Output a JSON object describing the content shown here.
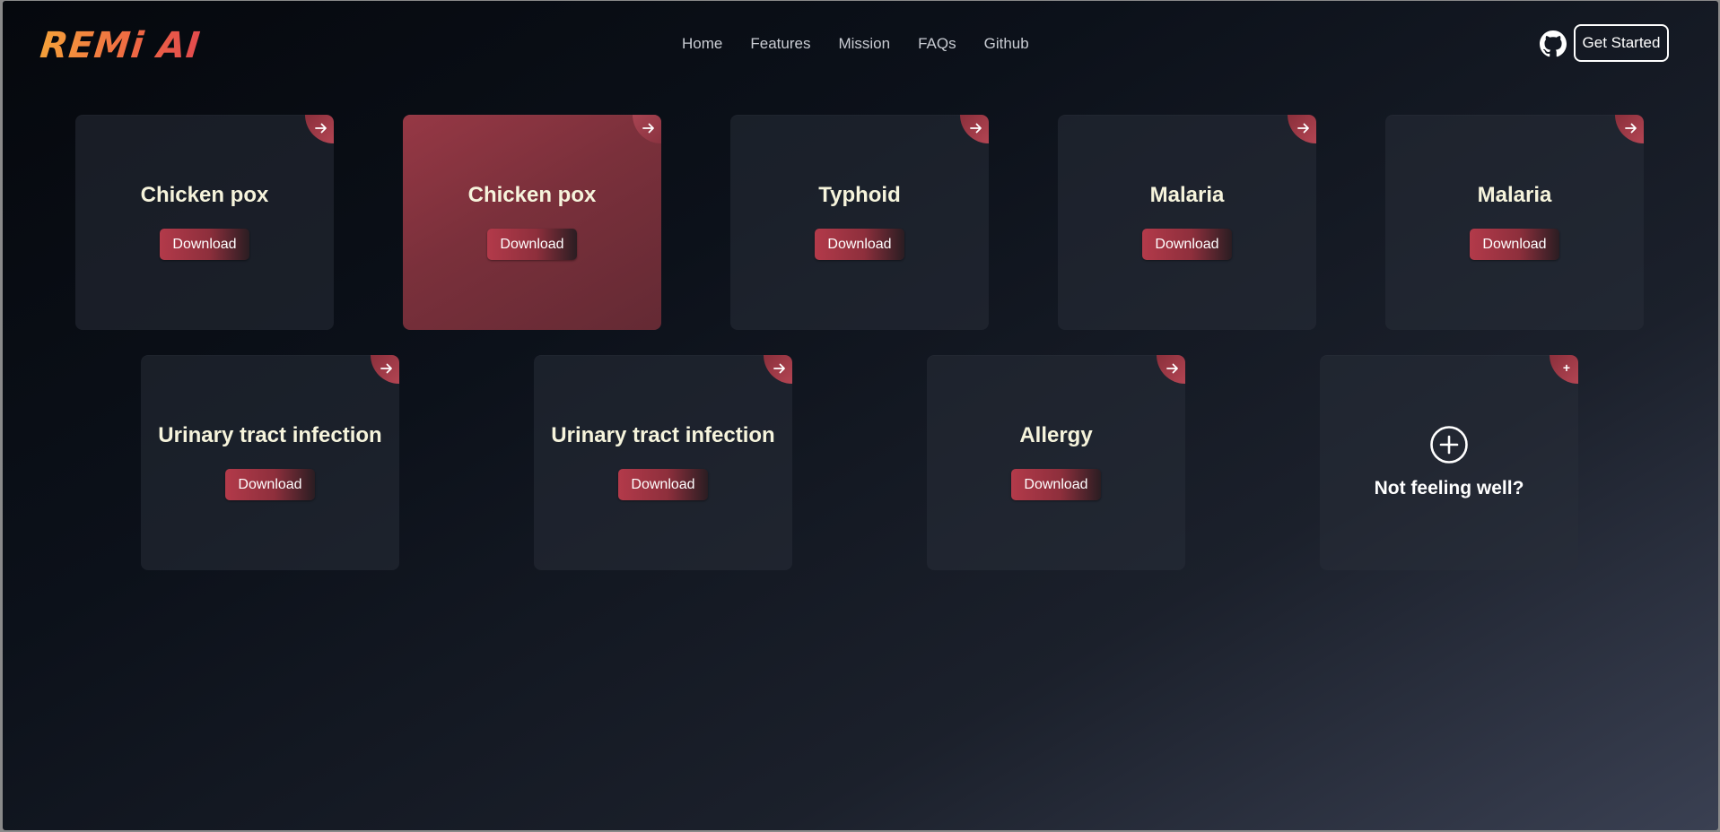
{
  "header": {
    "logo_text": "REMi AI",
    "nav": [
      "Home",
      "Features",
      "Mission",
      "FAQs",
      "Github"
    ],
    "github_icon": "github-icon",
    "cta_label": "Get Started"
  },
  "cards": [
    {
      "title": "Chicken pox",
      "button": "Download",
      "corner_icon": "arrow-right-icon"
    },
    {
      "title": "Chicken pox",
      "button": "Download",
      "corner_icon": "arrow-right-icon",
      "active": true
    },
    {
      "title": "Typhoid",
      "button": "Download",
      "corner_icon": "arrow-right-icon"
    },
    {
      "title": "Malaria",
      "button": "Download",
      "corner_icon": "arrow-right-icon"
    },
    {
      "title": "Malaria",
      "button": "Download",
      "corner_icon": "arrow-right-icon"
    },
    {
      "title": "Urinary tract infection",
      "button": "Download",
      "corner_icon": "arrow-right-icon"
    },
    {
      "title": "Urinary tract infection",
      "button": "Download",
      "corner_icon": "arrow-right-icon"
    },
    {
      "title": "Allergy",
      "button": "Download",
      "corner_icon": "arrow-right-icon"
    }
  ],
  "add_card": {
    "label": "Not feeling well?",
    "icon": "plus-circle-icon",
    "corner_icon": "plus-icon",
    "corner_symbol": "+"
  },
  "colors": {
    "accent": "#b33a4a",
    "active_card": "#963845",
    "title_text": "#f6f4dc"
  }
}
